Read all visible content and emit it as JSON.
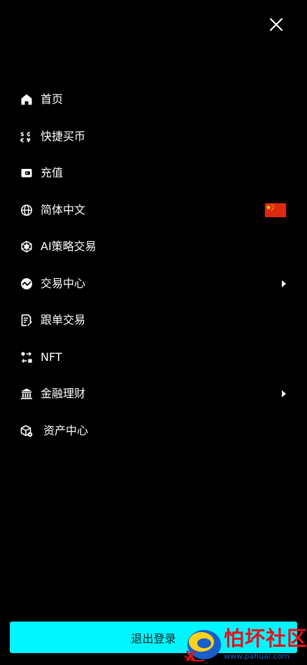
{
  "header": {
    "close_icon": "close-icon"
  },
  "menu": {
    "items": [
      {
        "label": "首页",
        "icon": "home-icon"
      },
      {
        "label": "快捷买币",
        "icon": "currency-exchange-icon"
      },
      {
        "label": "充值",
        "icon": "wallet-icon"
      },
      {
        "label": "简体中文",
        "icon": "globe-icon",
        "flag": "china-flag-icon"
      },
      {
        "label": "AI策略交易",
        "icon": "ai-cube-icon"
      },
      {
        "label": "交易中心",
        "icon": "trade-chart-icon",
        "has_submenu": true
      },
      {
        "label": "跟单交易",
        "icon": "copy-trade-icon"
      },
      {
        "label": "NFT",
        "icon": "nft-swap-icon"
      },
      {
        "label": "金融理财",
        "icon": "bank-icon",
        "has_submenu": true
      },
      {
        "label": "资产中心",
        "icon": "assets-box-icon"
      }
    ]
  },
  "footer": {
    "logout_label": "退出登录"
  },
  "watermark": {
    "title": "怕坏社区",
    "url": "www.pahuai.com"
  },
  "colors": {
    "background": "#000000",
    "text": "#ffffff",
    "accent": "#00f5ff",
    "flag_red": "#de2910",
    "flag_yellow": "#ffde00",
    "watermark_red": "#e8101b",
    "watermark_blue": "#1a5ec8"
  }
}
